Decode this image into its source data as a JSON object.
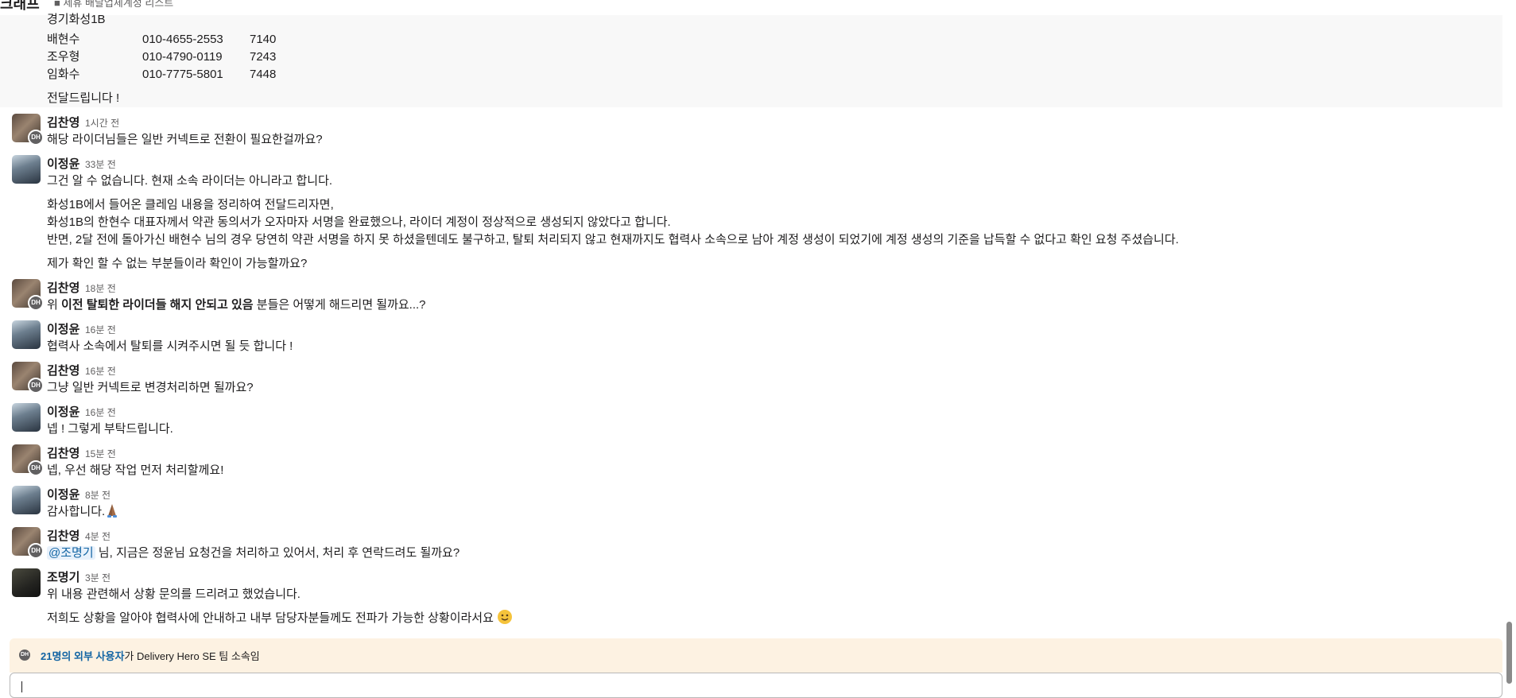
{
  "header": {
    "title": "크래프",
    "subtitle": "■ 제휴 배달업체계정 리스트"
  },
  "quoted": {
    "company": "경기화성1B",
    "riders": [
      {
        "name": "배현수",
        "phone": "010-4655-2553",
        "code": "7140"
      },
      {
        "name": "조우형",
        "phone": "010-4790-0119",
        "code": "7243"
      },
      {
        "name": "임화수",
        "phone": "010-7775-5801",
        "code": "7448"
      }
    ],
    "closing": "전달드립니다 !"
  },
  "messages": [
    {
      "sender": "김찬영",
      "time": "1시간 전",
      "lines": [
        "해당 라이더님들은 일반 커넥트로 전환이 필요한걸까요?"
      ]
    },
    {
      "sender": "이정윤",
      "time": "33분 전",
      "lines": [
        "그건 알 수 없습니다. 현재 소속 라이더는 아니라고 합니다.",
        "화성1B에서 들어온 클레임 내용을 정리하여 전달드리자면,",
        "화성1B의 한현수 대표자께서 약관 동의서가 오자마자 서명을 완료했으나, 라이더 계정이 정상적으로 생성되지 않았다고 합니다.",
        "반면, 2달 전에 돌아가신 배현수 님의 경우 당연히 약관 서명을 하지 못 하셨을텐데도 불구하고, 탈퇴 처리되지 않고 현재까지도 협력사 소속으로 남아 계정 생성이 되었기에 계정 생성의 기준을 납득할 수 없다고 확인 요청 주셨습니다.",
        "제가 확인 할 수 없는 부분들이라 확인이 가능할까요?"
      ]
    },
    {
      "sender": "김찬영",
      "time": "18분 전",
      "prefix": "위 ",
      "bold": "이전 탈퇴한 라이더들 해지 안되고 있음",
      "suffix": " 분들은 어떻게 해드리면 될까요...?"
    },
    {
      "sender": "이정윤",
      "time": "16분 전",
      "lines": [
        "협력사 소속에서 탈퇴를 시켜주시면 될 듯 합니다 !"
      ]
    },
    {
      "sender": "김찬영",
      "time": "16분 전",
      "lines": [
        "그냥 일반 커넥트로 변경처리하면 될까요?"
      ]
    },
    {
      "sender": "이정윤",
      "time": "16분 전",
      "lines": [
        "넵 ! 그렇게 부탁드립니다."
      ]
    },
    {
      "sender": "김찬영",
      "time": "15분 전",
      "lines": [
        "넵, 우선 해당 작업 먼저 처리할께요!"
      ]
    },
    {
      "sender": "이정윤",
      "time": "8분 전",
      "lines": [
        "감사합니다."
      ],
      "emoji": "folded-hands"
    },
    {
      "sender": "김찬영",
      "time": "4분 전",
      "mention": "@조명기",
      "rest": " 님, 지금은 정윤님 요청건을 처리하고 있어서, 처리 후 연락드려도 될까요?"
    },
    {
      "sender": "조명기",
      "time": "3분 전",
      "lines": [
        "위 내용 관련해서 상황 문의를 드리려고 했었습니다.",
        "저희도 상황을 알아야 협력사에 안내하고 내부 담당자분들께도 전파가 가능한 상황이라서요"
      ],
      "emoji": "slightly-smiling-face"
    }
  ],
  "badge_text": "DH",
  "notice": {
    "link_text": "21명의 외부 사용자",
    "rest_text": "가 Delivery Hero SE 팀 소속임"
  },
  "colors": {
    "link": "#1264a3",
    "notice_bg": "#fdf2e2",
    "quoted_bg": "#f8f8f8"
  }
}
